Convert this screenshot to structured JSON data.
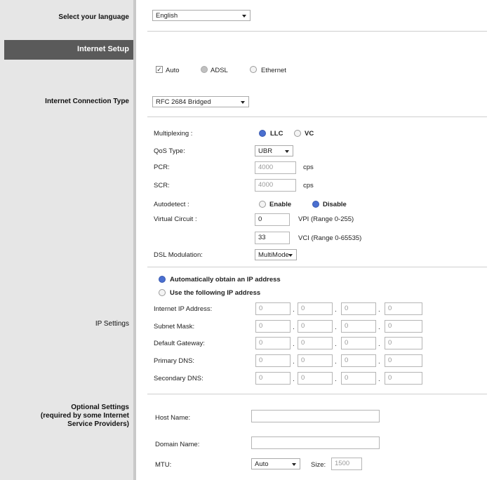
{
  "language": {
    "label": "Select your language",
    "value": "English"
  },
  "section": {
    "title": "Internet Setup"
  },
  "connection_mode": {
    "auto": "Auto",
    "adsl": "ADSL",
    "ethernet": "Ethernet"
  },
  "connection_type": {
    "label": "Internet Connection Type",
    "value": "RFC 2684 Bridged"
  },
  "multiplexing": {
    "label": "Multiplexing :",
    "llc": "LLC",
    "vc": "VC"
  },
  "qos": {
    "label": "QoS Type:",
    "value": "UBR"
  },
  "pcr": {
    "label": "PCR:",
    "value": "4000",
    "unit": "cps"
  },
  "scr": {
    "label": "SCR:",
    "value": "4000",
    "unit": "cps"
  },
  "autodetect": {
    "label": "Autodetect :",
    "enable": "Enable",
    "disable": "Disable"
  },
  "virtual_circuit": {
    "label": "Virtual Circuit :",
    "vpi_value": "0",
    "vpi_range": "VPI (Range 0-255)",
    "vci_value": "33",
    "vci_range": "VCI (Range 0-65535)"
  },
  "dsl_modulation": {
    "label": "DSL Modulation:",
    "value": "MultiMode"
  },
  "ip_settings": {
    "label": "IP Settings",
    "auto_option": "Automatically obtain an IP address",
    "static_option": "Use the following IP address",
    "rows": [
      {
        "label": "Internet IP Address:",
        "octets": [
          "0",
          "0",
          "0",
          "0"
        ]
      },
      {
        "label": "Subnet Mask:",
        "octets": [
          "0",
          "0",
          "0",
          "0"
        ]
      },
      {
        "label": "Default Gateway:",
        "octets": [
          "0",
          "0",
          "0",
          "0"
        ]
      },
      {
        "label": "Primary DNS:",
        "octets": [
          "0",
          "0",
          "0",
          "0"
        ]
      },
      {
        "label": "Secondary DNS:",
        "octets": [
          "0",
          "0",
          "0",
          "0"
        ]
      }
    ]
  },
  "optional": {
    "label_line1": "Optional Settings",
    "label_line2": "(required by some Internet",
    "label_line3": "Service Providers)",
    "host_name": "Host Name:",
    "domain_name": "Domain Name:",
    "mtu_label": "MTU:",
    "mtu_value": "Auto",
    "size_label": "Size:",
    "size_value": "1500"
  },
  "colors": {
    "sidebar": "#e6e6e6",
    "section_bar": "#5a5a5a",
    "radio_on": "#4a6fd0"
  }
}
